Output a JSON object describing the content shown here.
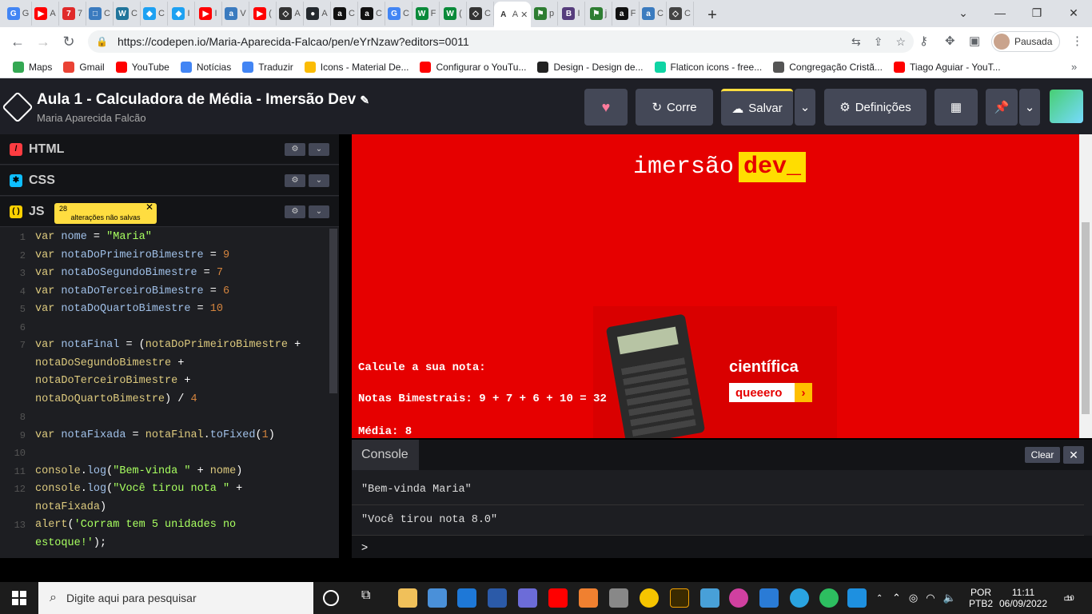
{
  "browser": {
    "tabs": [
      {
        "icon": "G",
        "color": "#4285f4",
        "short": "G"
      },
      {
        "icon": "▶",
        "color": "#ff0000",
        "short": "A"
      },
      {
        "icon": "7",
        "color": "#e02a2a",
        "short": "7"
      },
      {
        "icon": "□",
        "color": "#3b7bbf",
        "short": "C"
      },
      {
        "icon": "W",
        "color": "#21759b",
        "short": "C"
      },
      {
        "icon": "◆",
        "color": "#1da1f2",
        "short": "C"
      },
      {
        "icon": "◆",
        "color": "#1da1f2",
        "short": "I"
      },
      {
        "icon": "▶",
        "color": "#ff0000",
        "short": "I"
      },
      {
        "icon": "a",
        "color": "#3b7bbf",
        "short": "V"
      },
      {
        "icon": "▶",
        "color": "#ff0000",
        "short": "("
      },
      {
        "icon": "◇",
        "color": "#333333",
        "short": "A"
      },
      {
        "icon": "●",
        "color": "#24292e",
        "short": "A"
      },
      {
        "icon": "a",
        "color": "#111111",
        "short": "C"
      },
      {
        "icon": "a",
        "color": "#111111",
        "short": "C"
      },
      {
        "icon": "G",
        "color": "#4285f4",
        "short": "C"
      },
      {
        "icon": "W",
        "color": "#0a8a3a",
        "short": "F"
      },
      {
        "icon": "W",
        "color": "#0a8a3a",
        "short": "("
      },
      {
        "icon": "◇",
        "color": "#333333",
        "short": "C"
      },
      {
        "icon": "A",
        "color": "#ffffff",
        "short": "A"
      },
      {
        "icon": "⚑",
        "color": "#2e7d32",
        "short": "p"
      },
      {
        "icon": "B",
        "color": "#563d7c",
        "short": "I"
      },
      {
        "icon": "⚑",
        "color": "#2e7d32",
        "short": "j"
      },
      {
        "icon": "a",
        "color": "#111111",
        "short": "F"
      },
      {
        "icon": "a",
        "color": "#3b7bbf",
        "short": "C"
      },
      {
        "icon": "◇",
        "color": "#444444",
        "short": "C"
      }
    ],
    "url": "https://codepen.io/Maria-Aparecida-Falcao/pen/eYrNzaw?editors=0011",
    "profile_label": "Pausada",
    "bookmarks": [
      {
        "label": "Maps",
        "color": "#34a853"
      },
      {
        "label": "Gmail",
        "color": "#ea4335"
      },
      {
        "label": "YouTube",
        "color": "#ff0000"
      },
      {
        "label": "Notícias",
        "color": "#4285f4"
      },
      {
        "label": "Traduzir",
        "color": "#4285f4"
      },
      {
        "label": "Icons - Material De...",
        "color": "#fbbc05"
      },
      {
        "label": "Configurar o YouTu...",
        "color": "#ff0000"
      },
      {
        "label": "Design - Design de...",
        "color": "#222222"
      },
      {
        "label": "Flaticon icons - free...",
        "color": "#0fd4a4"
      },
      {
        "label": "Congregação Cristã...",
        "color": "#555555"
      },
      {
        "label": "Tiago Aguiar - YouT...",
        "color": "#ff0000"
      }
    ]
  },
  "codepen": {
    "title": "Aula 1 - Calculadora de Média - Imersão Dev",
    "author": "Maria Aparecida Falcão",
    "run_label": "Corre",
    "save_label": "Salvar",
    "settings_label": "Definições",
    "panels": {
      "html": "HTML",
      "css": "CSS",
      "js": "JS"
    },
    "unsaved": {
      "count": "28",
      "text": "alterações não salvas"
    },
    "code_lines": [
      {
        "n": "1",
        "html": "<span class='kw'>var</span> <span class='vr'>nome</span> = <span class='st'>\"Maria\"</span>"
      },
      {
        "n": "2",
        "html": "<span class='kw'>var</span> <span class='vr'>notaDoPrimeiroBimestre</span> = <span class='nm'>9</span>"
      },
      {
        "n": "3",
        "html": "<span class='kw'>var</span> <span class='vr'>notaDoSegundoBimestre</span> = <span class='nm'>7</span>"
      },
      {
        "n": "4",
        "html": "<span class='kw'>var</span> <span class='vr'>notaDoTerceiroBimestre</span> = <span class='nm'>6</span>"
      },
      {
        "n": "5",
        "html": "<span class='kw'>var</span> <span class='vr'>notaDoQuartoBimestre</span> = <span class='nm'>10</span>"
      },
      {
        "n": "6",
        "html": ""
      },
      {
        "n": "7",
        "html": "<span class='kw'>var</span> <span class='vr'>notaFinal</span> = (<span class='kw'>notaDoPrimeiroBimestre</span> +"
      },
      {
        "n": "",
        "html": "<span class='kw'>notaDoSegundoBimestre</span> +"
      },
      {
        "n": "",
        "html": "<span class='kw'>notaDoTerceiroBimestre</span> +"
      },
      {
        "n": "",
        "html": "<span class='kw'>notaDoQuartoBimestre</span>) / <span class='nm'>4</span>"
      },
      {
        "n": "8",
        "html": ""
      },
      {
        "n": "9",
        "html": "<span class='kw'>var</span> <span class='vr'>notaFixada</span> = <span class='kw'>notaFinal</span>.<span class='fn'>toFixed</span>(<span class='nm'>1</span>)"
      },
      {
        "n": "10",
        "html": ""
      },
      {
        "n": "11",
        "html": "<span class='kw'>console</span>.<span class='fn'>log</span>(<span class='st'>\"Bem-vinda \"</span> + <span class='kw'>nome</span>)"
      },
      {
        "n": "12",
        "html": "<span class='kw'>console</span>.<span class='fn'>log</span>(<span class='st'>\"Você tirou nota \"</span> +"
      },
      {
        "n": "",
        "html": "<span class='kw'>notaFixada</span>)"
      },
      {
        "n": "13",
        "html": "<span class='kw'>alert</span>(<span class='st'>'Corram tem 5 unidades no</span>"
      },
      {
        "n": "",
        "html": "<span class='st'>estoque!'</span>);"
      }
    ]
  },
  "preview": {
    "brand_prefix": "imersão",
    "brand_suffix": "dev_",
    "line1": "Calcule a sua nota:",
    "line2": "Notas Bimestrais: 9 + 7 + 6 + 10 = 32",
    "line3": "Média: 8",
    "ad_word": "científica",
    "ad_button": "queeero"
  },
  "console": {
    "tab": "Console",
    "clear": "Clear",
    "lines": [
      "\"Bem-vinda Maria\"",
      "\"Você tirou nota 8.0\""
    ],
    "prompt": ">"
  },
  "taskbar": {
    "search_placeholder": "Digite aqui para pesquisar",
    "lang_top": "POR",
    "lang_bottom": "PTB2",
    "time": "11:11",
    "date": "06/09/2022",
    "notif_count": "10"
  }
}
